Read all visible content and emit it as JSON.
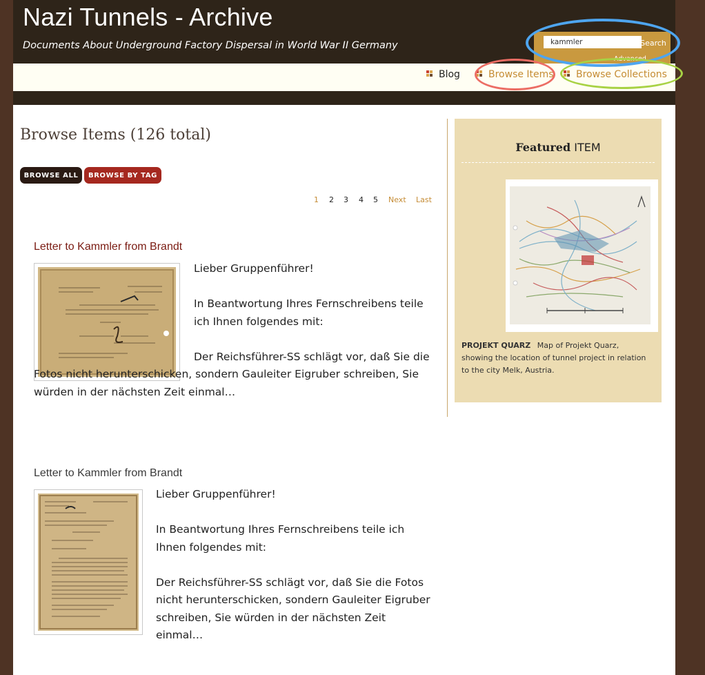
{
  "site": {
    "title": "Nazi Tunnels - Archive",
    "subtitle": "Documents About Underground Factory Dispersal in World War II Germany"
  },
  "search": {
    "value": "kammler",
    "button_label": "Search",
    "advanced_label": "Advanced Search"
  },
  "nav": {
    "items": [
      {
        "label": "Blog"
      },
      {
        "label": "Browse Items"
      },
      {
        "label": "Browse Collections"
      }
    ]
  },
  "main": {
    "heading": "Browse Items (126 total)",
    "buttons": {
      "browse_all": "BROWSE ALL",
      "browse_by_tag": "BROWSE BY TAG"
    },
    "pagination": {
      "pages": [
        "1",
        "2",
        "3",
        "4",
        "5"
      ],
      "current": "1",
      "next": "Next",
      "last": "Last"
    },
    "items": [
      {
        "title": "Letter to Kammler from Brandt",
        "paragraphs": [
          "Lieber Gruppenführer!",
          "In Beantwortung Ihres Fernschreibens teile ich Ihnen folgendes mit:",
          "Der Reichsführer-SS schlägt vor, daß Sie die Fotos nicht herunterschicken, sondern Gauleiter Eigruber schreiben, Sie würden in der nächsten Zeit einmal…"
        ]
      },
      {
        "title": "Letter to Kammler from Brandt",
        "paragraphs": [
          "Lieber Gruppenführer!",
          "In Beantwortung Ihres Fernschreibens teile ich Ihnen folgendes mit:",
          "Der Reichsführer-SS schlägt vor, daß Sie die Fotos nicht herunterschicken, sondern Gauleiter Eigruber schreiben, Sie würden in der nächsten Zeit einmal…"
        ]
      }
    ]
  },
  "featured": {
    "heading_bold": "Featured",
    "heading_rest": "ITEM",
    "item_title": "PROJEKT QUARZ",
    "description": "Map of Projekt Quarz, showing the location of tunnel project in relation to the city Melk, Austria."
  },
  "colors": {
    "header_bg": "#2e2419",
    "page_bg": "#4e3324",
    "search_bg": "#c9993f",
    "link_gold": "#c58c35",
    "item_title_red": "#7a1b12",
    "btn_dark": "#2a1a13",
    "btn_red": "#a5281f",
    "featured_bg": "#ecdcb2",
    "ring_blue": "#4ea5ef",
    "ring_red": "#ec6d64",
    "ring_green": "#a8d244"
  }
}
